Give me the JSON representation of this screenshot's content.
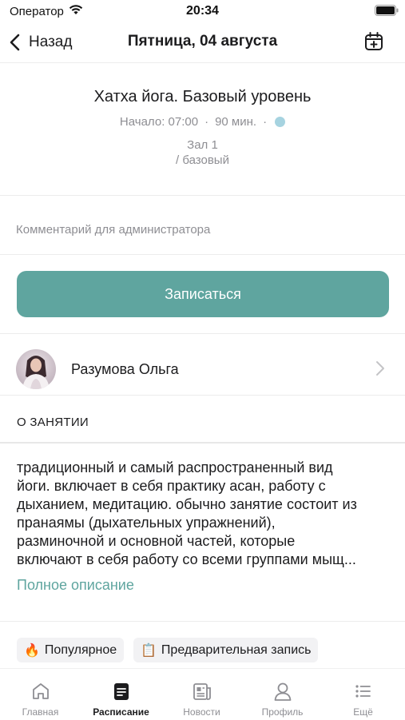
{
  "status_bar": {
    "carrier": "Оператор",
    "time": "20:34",
    "icons": [
      "wifi-icon",
      "battery-icon"
    ]
  },
  "nav": {
    "back_label": "Назад",
    "title": "Пятница, 04 августа",
    "right_icon": "calendar-plus-icon"
  },
  "class_info": {
    "title": "Хатха йога. Базовый уровень",
    "start": "Начало: 07:00",
    "separator": "·",
    "duration": "90 мин.",
    "color": "#a6d3e0",
    "hall_line1": "Зал 1",
    "hall_line2": "/ базовый"
  },
  "comment": {
    "placeholder": "Комментарий для администратора",
    "value": ""
  },
  "signup": {
    "label": "Записаться",
    "color": "#5fa59f"
  },
  "trainer": {
    "name": "Разумова Ольга"
  },
  "about": {
    "header": "О ЗАНЯТИИ",
    "lines": [
      "традиционный и самый распространенный вид",
      "йоги. включает в себя практику асан, работу с",
      "дыханием, медитацию. обычно занятие состоит из",
      "пранаямы (дыхательных упражнений),",
      "разминочной и основной частей, которые",
      "включают в себя работу со всеми группами мыщ..."
    ],
    "full_link": "Полное описание",
    "link_color": "#5fa59f"
  },
  "tags": [
    {
      "icon": "🔥",
      "icon_name": "fire-icon",
      "label": "Популярное"
    },
    {
      "icon": "📋",
      "icon_name": "clipboard-icon",
      "label": "Предварительная запись"
    }
  ],
  "tab_bar": {
    "items": [
      {
        "label": "Главная",
        "icon": "home-icon",
        "active": false
      },
      {
        "label": "Расписание",
        "icon": "schedule-icon",
        "active": true
      },
      {
        "label": "Новости",
        "icon": "news-icon",
        "active": false
      },
      {
        "label": "Профиль",
        "icon": "profile-icon",
        "active": false
      },
      {
        "label": "Ещё",
        "icon": "more-icon",
        "active": false
      }
    ]
  }
}
